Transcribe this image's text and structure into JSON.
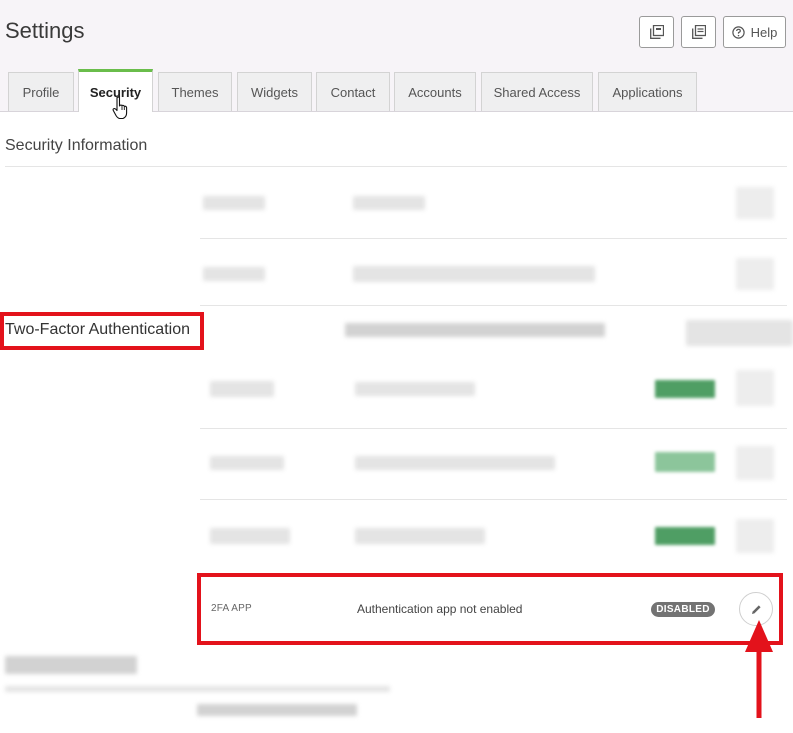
{
  "header": {
    "title": "Settings",
    "buttons": [
      {
        "name": "copy-icon-button-1",
        "icon": "copy-icon"
      },
      {
        "name": "copy-icon-button-2",
        "icon": "document-stack-icon"
      },
      {
        "name": "help-button",
        "icon": "question-circle-icon",
        "label": "Help"
      }
    ]
  },
  "tabs": [
    {
      "label": "Profile"
    },
    {
      "label": "Security",
      "active": true
    },
    {
      "label": "Themes"
    },
    {
      "label": "Widgets"
    },
    {
      "label": "Contact"
    },
    {
      "label": "Accounts"
    },
    {
      "label": "Shared Access"
    },
    {
      "label": "Applications"
    }
  ],
  "security": {
    "section_title": "Security Information",
    "two_factor_title": "Two-Factor Authentication",
    "app_row": {
      "label": "2FA APP",
      "value": "Authentication app not enabled",
      "status": "DISABLED",
      "action_icon": "pencil-icon"
    }
  },
  "colors": {
    "accent_tab": "#6abd4b",
    "highlight": "#e3121b",
    "badge": "#737373"
  }
}
